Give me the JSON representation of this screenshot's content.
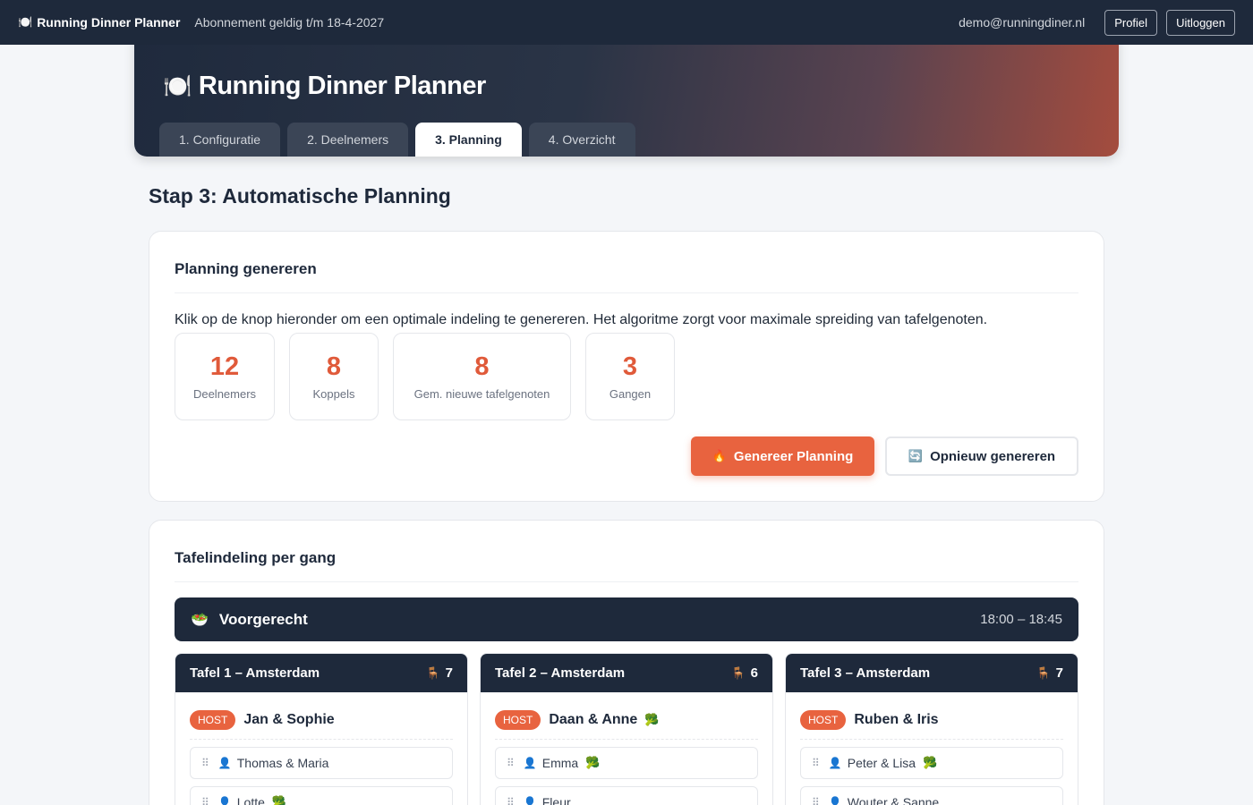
{
  "topbar": {
    "brand_icon": "plate-icon",
    "brand": "Running Dinner Planner",
    "subscription": "Abonnement geldig t/m 18-4-2027",
    "email": "demo@runningdiner.nl",
    "profile_label": "Profiel",
    "logout_label": "Uitloggen"
  },
  "hero": {
    "title": "Running Dinner Planner",
    "tabs": [
      {
        "label": "1. Configuratie"
      },
      {
        "label": "2. Deelnemers"
      },
      {
        "label": "3. Planning"
      },
      {
        "label": "4. Overzicht"
      }
    ],
    "active_tab": 2
  },
  "page": {
    "step_title": "Stap 3: Automatische Planning"
  },
  "generate": {
    "heading": "Planning genereren",
    "description": "Klik op de knop hieronder om een optimale indeling te genereren. Het algoritme zorgt voor maximale spreiding van tafelgenoten.",
    "stats": [
      {
        "value": "12",
        "label": "Deelnemers"
      },
      {
        "value": "8",
        "label": "Koppels"
      },
      {
        "value": "8",
        "label": "Gem. nieuwe tafelgenoten"
      },
      {
        "value": "3",
        "label": "Gangen"
      }
    ],
    "primary_label": "Genereer Planning",
    "secondary_label": "Opnieuw genereren"
  },
  "layout": {
    "heading": "Tafelindeling per gang",
    "course": {
      "name": "Voorgerecht",
      "time": "18:00 – 18:45"
    },
    "tables": [
      {
        "title": "Tafel 1 – Amsterdam",
        "seats": "7",
        "host": "Jan & Sophie",
        "host_veg": false,
        "guests": [
          {
            "name": "Thomas & Maria",
            "veg": false
          },
          {
            "name": "Lotte",
            "veg": true
          }
        ]
      },
      {
        "title": "Tafel 2 – Amsterdam",
        "seats": "6",
        "host": "Daan & Anne",
        "host_veg": true,
        "guests": [
          {
            "name": "Emma",
            "veg": true
          },
          {
            "name": "Fleur",
            "veg": false
          }
        ]
      },
      {
        "title": "Tafel 3 – Amsterdam",
        "seats": "7",
        "host": "Ruben & Iris",
        "host_veg": false,
        "guests": [
          {
            "name": "Peter & Lisa",
            "veg": true
          },
          {
            "name": "Wouter & Sanne",
            "veg": false
          }
        ]
      }
    ],
    "host_badge": "HOST"
  },
  "colors": {
    "accent": "#e8633f",
    "dark": "#1e293b"
  }
}
